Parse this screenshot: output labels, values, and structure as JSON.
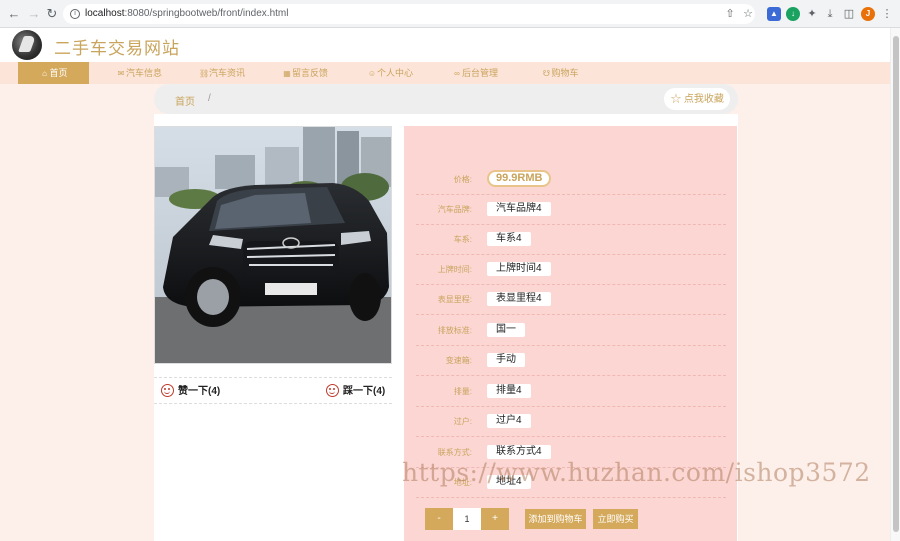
{
  "browser": {
    "url_host": "localhost",
    "url_path": ":8080/springbootweb/front/index.html",
    "avatar_letter": "J"
  },
  "site": {
    "title": "二手车交易网站"
  },
  "nav": {
    "items": [
      {
        "label": "首页",
        "icon": "home-icon"
      },
      {
        "label": "汽车信息",
        "icon": "mail-icon"
      },
      {
        "label": "汽车资讯",
        "icon": "car-icon"
      },
      {
        "label": "留言反馈",
        "icon": "image-icon"
      },
      {
        "label": "个人中心",
        "icon": "user-icon"
      },
      {
        "label": "后台管理",
        "icon": "link-icon"
      },
      {
        "label": "购物车",
        "icon": "cart-icon"
      }
    ],
    "active_index": 0
  },
  "breadcrumb": {
    "home": "首页",
    "separator": "/",
    "favorite_label": "点我收藏"
  },
  "votes": {
    "like_label": "赞一下(4)",
    "dislike_label": "踩一下(4)"
  },
  "details": {
    "price_label": "价格:",
    "price_value": "99.9RMB",
    "rows": [
      {
        "label": "汽车品牌:",
        "value": "汽车品牌4"
      },
      {
        "label": "车系:",
        "value": "车系4"
      },
      {
        "label": "上牌时间:",
        "value": "上牌时间4"
      },
      {
        "label": "表显里程:",
        "value": "表显里程4"
      },
      {
        "label": "排放标准:",
        "value": "国一"
      },
      {
        "label": "变速箱:",
        "value": "手动"
      },
      {
        "label": "排量:",
        "value": "排量4"
      },
      {
        "label": "过户:",
        "value": "过户4"
      },
      {
        "label": "联系方式:",
        "value": "联系方式4"
      },
      {
        "label": "地址:",
        "value": "地址4"
      }
    ]
  },
  "purchase": {
    "minus": "-",
    "quantity": "1",
    "plus": "+",
    "add_to_cart": "添加到购物车",
    "buy_now": "立即购买"
  },
  "watermark": {
    "text": "https://www.huzhan.com/ishop3572"
  },
  "colors": {
    "accent": "#d4a95b",
    "accent_text": "#c9a45c",
    "details_bg": "#fcd6d3",
    "nav_bg": "#fde4d8",
    "page_bg": "#fdf0ea"
  }
}
